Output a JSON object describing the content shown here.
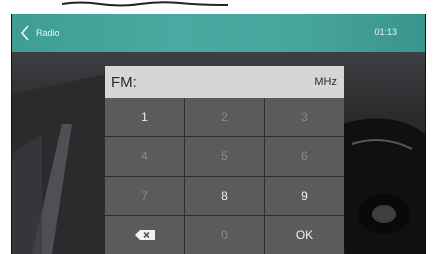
{
  "header": {
    "back_label": "Radio",
    "clock": "01:13"
  },
  "display": {
    "band": "FM:",
    "unit": "MHz"
  },
  "keypad": {
    "keys": [
      {
        "label": "1",
        "enabled": true
      },
      {
        "label": "2",
        "enabled": false
      },
      {
        "label": "3",
        "enabled": false
      },
      {
        "label": "4",
        "enabled": false
      },
      {
        "label": "5",
        "enabled": false
      },
      {
        "label": "6",
        "enabled": false
      },
      {
        "label": "7",
        "enabled": false
      },
      {
        "label": "8",
        "enabled": true
      },
      {
        "label": "9",
        "enabled": true
      },
      {
        "label": "",
        "icon": "backspace-icon",
        "enabled": true
      },
      {
        "label": "0",
        "enabled": false
      },
      {
        "label": "OK",
        "enabled": true
      }
    ]
  },
  "colors": {
    "header_teal": "#47a59c",
    "key_background": "#5b5b5b",
    "display_background": "#d6d6d6",
    "key_enabled_text": "#f2f2f2",
    "key_disabled_text": "#8a8a8a"
  }
}
